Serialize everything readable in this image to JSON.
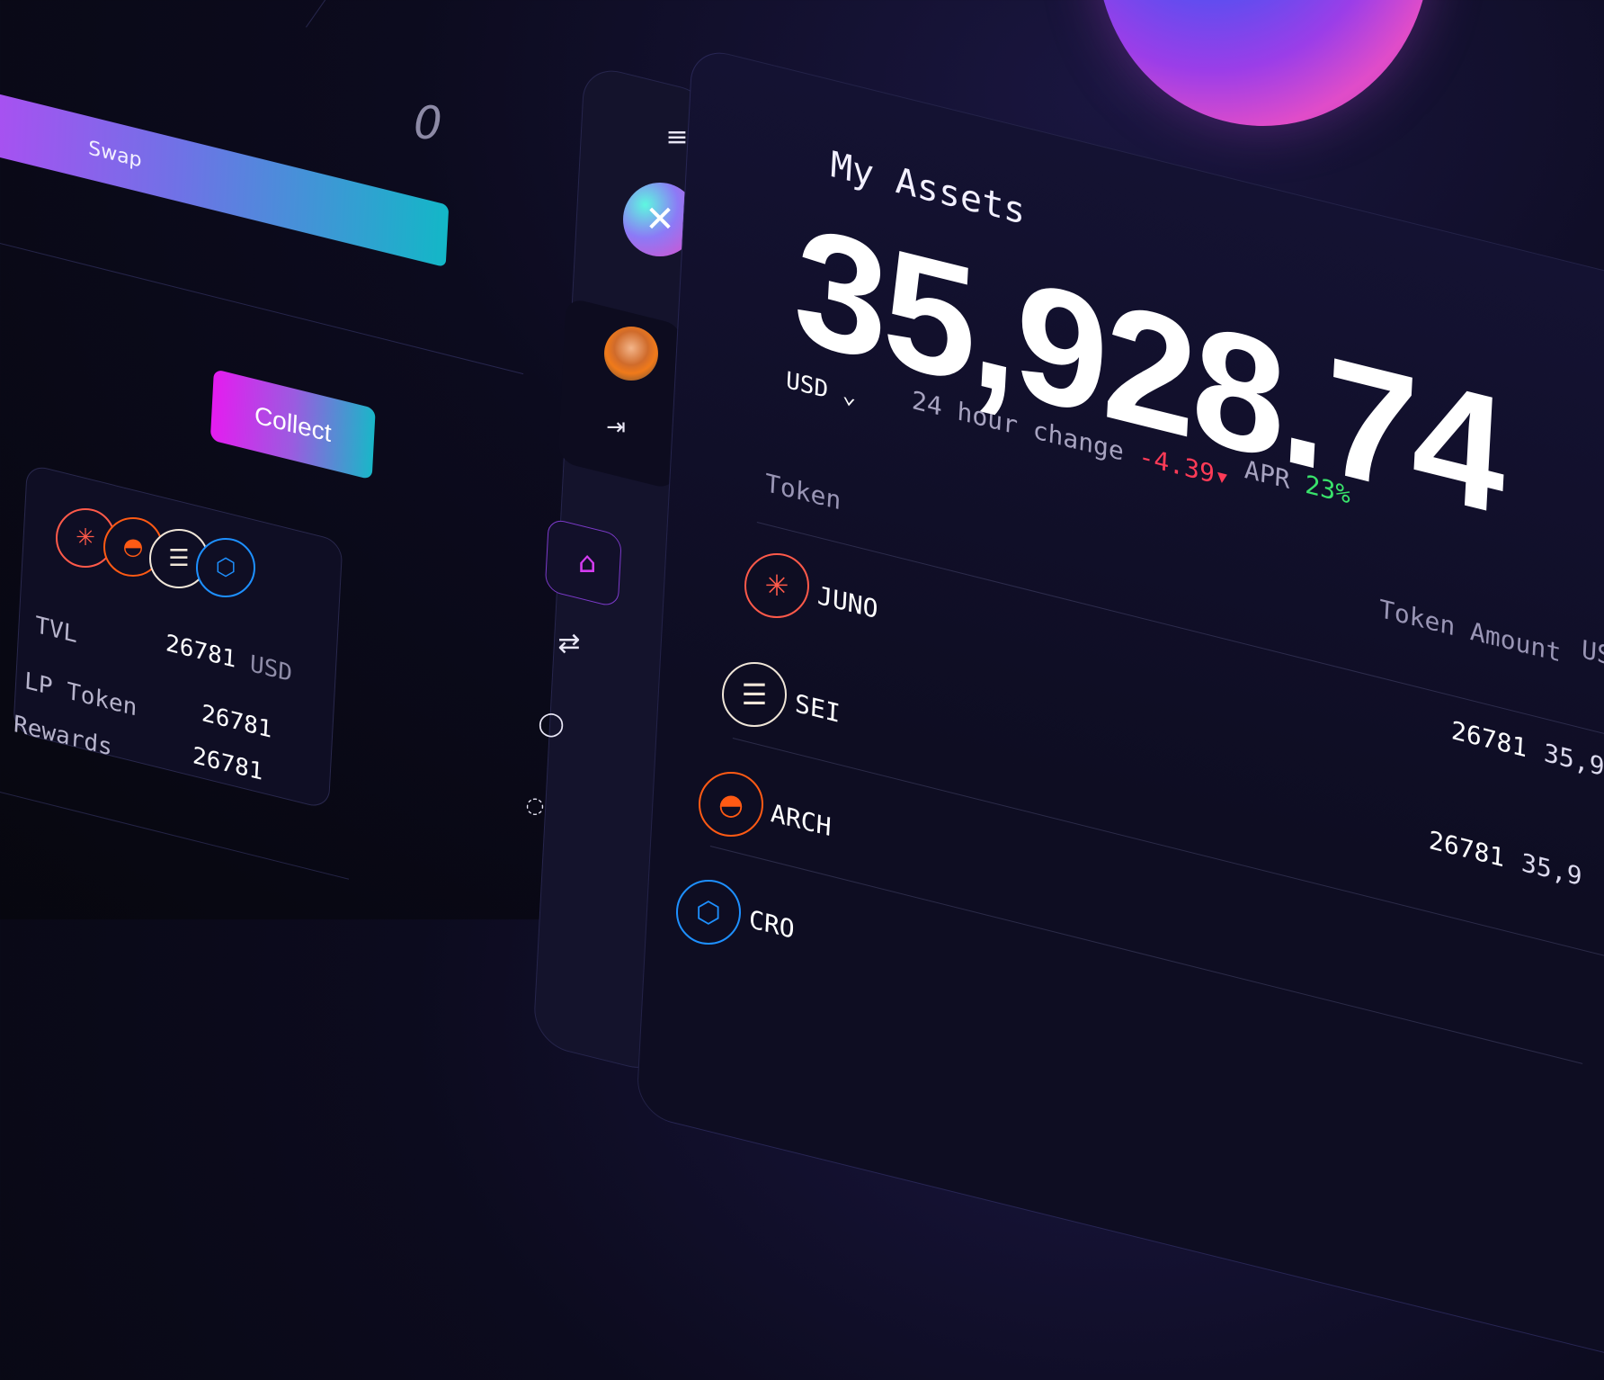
{
  "swap": {
    "label": "Swap",
    "amount": "0"
  },
  "pool": {
    "collect_label": "Collect",
    "coins": [
      "juno-icon",
      "arch-icon",
      "sei-icon",
      "cro-icon"
    ],
    "tvl_label": "TVL",
    "tvl_value": "26781",
    "tvl_unit": "USD",
    "lp_label": "LP Token",
    "lp_value": "26781",
    "rewards_label": "Rewards",
    "rewards_value": "26781"
  },
  "sidebar": {
    "items": [
      "menu-icon",
      "logo",
      "avatar",
      "logout-icon",
      "home-icon",
      "swap-arrows-icon",
      "drop-icon",
      "chat-icon"
    ]
  },
  "assets": {
    "title": "My Assets",
    "total": "35,928.74",
    "currency": "USD",
    "change_label": "24 hour change",
    "change_value": "-4.39",
    "apr_label": "APR",
    "apr_value": "23%"
  },
  "table": {
    "headers": {
      "token": "Token",
      "amount": "Token Amount",
      "usd": "US"
    },
    "rows": [
      {
        "token": "JUNO",
        "amount": "",
        "usd": "",
        "color": "#ff5a4a"
      },
      {
        "token": "SEI",
        "amount": "26781",
        "usd": "35,9",
        "color": "#f0e6d8"
      },
      {
        "token": "ARCH",
        "amount": "26781",
        "usd": "35,9",
        "color": "#ff5a14"
      },
      {
        "token": "CRO",
        "amount": "",
        "usd": "",
        "color": "#1e90ff"
      }
    ]
  },
  "colors": {
    "accent_pink": "#e51cf0",
    "accent_cyan": "#13b7c7",
    "negative": "#ff3b57",
    "positive": "#39e36b"
  }
}
